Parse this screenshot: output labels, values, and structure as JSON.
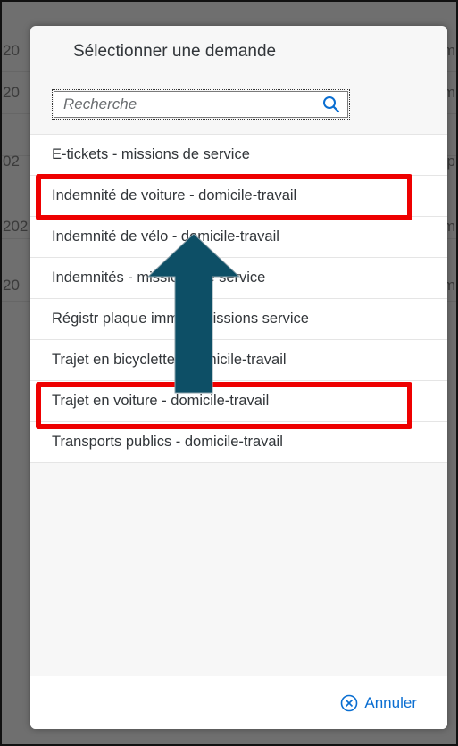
{
  "background": {
    "rows": [
      {
        "left": "20",
        "right": "m"
      },
      {
        "left": "20",
        "right": "m"
      },
      {
        "left": "02",
        "right": "p"
      },
      {
        "left": "202",
        "right": "m"
      },
      {
        "left": "20",
        "right": "m"
      }
    ]
  },
  "dialog": {
    "title": "Sélectionner une demande",
    "search": {
      "placeholder": "Recherche",
      "icon": "search-icon"
    },
    "items": [
      "E-tickets - missions de service",
      "Indemnité de voiture - domicile-travail",
      "Indemnité de vélo - domicile-travail",
      "Indemnités - missions de service",
      "Régistr plaque immatr-missions service",
      "Trajet en bicyclette - domicile-travail",
      "Trajet en voiture - domicile-travail",
      "Transports publics - domicile-travail"
    ],
    "cancel_label": "Annuler",
    "cancel_icon": "close-circle-icon"
  },
  "annotations": {
    "highlight_color": "#ee0000",
    "arrow_color": "#0d4f66",
    "highlighted_items": [
      1,
      6
    ]
  }
}
